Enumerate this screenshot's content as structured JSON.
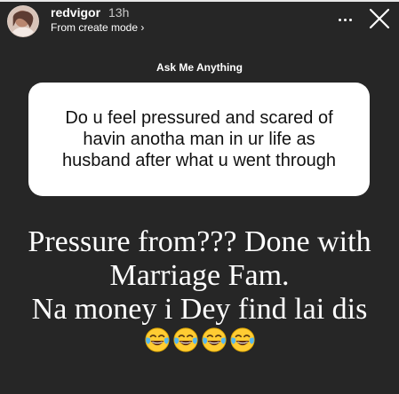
{
  "story": {
    "username": "redvigor",
    "time": "13h",
    "subtitle": "From create mode ›",
    "progress": 1.0
  },
  "prompt": {
    "title": "Ask Me Anything"
  },
  "question": {
    "text": "Do u feel pressured and scared of havin anotha man in ur life as husband after what u went through"
  },
  "answer": {
    "lines": [
      "Pressure from??? Done with",
      "Marriage Fam.",
      "Na money i Dey find lai dis"
    ],
    "emojis": [
      "joy-emoji",
      "joy-emoji",
      "joy-emoji",
      "joy-emoji"
    ]
  },
  "icons": {
    "more": "more-dots-icon",
    "close": "close-icon",
    "avatar": "avatar"
  },
  "colors": {
    "background": "#262626",
    "card": "#ffffff",
    "question_text": "#111111",
    "text": "#ffffff"
  }
}
